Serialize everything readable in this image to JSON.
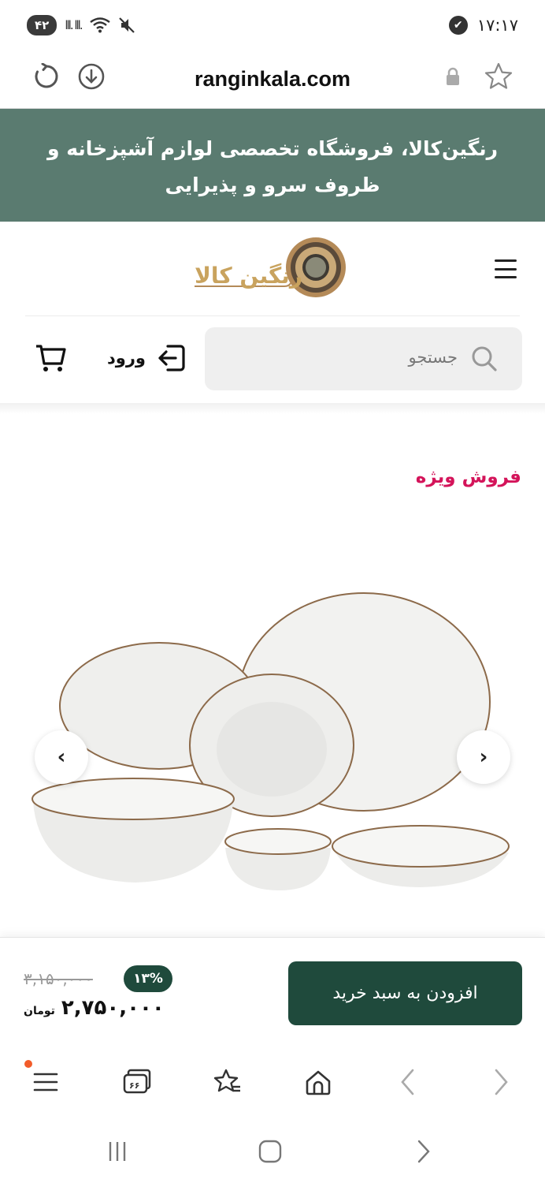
{
  "status_bar": {
    "time": "۱۷:۱۷",
    "battery": "۴۲",
    "signal": "lll. lll."
  },
  "browser": {
    "url": "ranginkala.com",
    "icons": [
      "refresh-icon",
      "download-icon",
      "lock-icon",
      "star-icon"
    ]
  },
  "banner": {
    "text": "رنگین‌کالا، فروشگاه تخصصی لوازم آشپزخانه و ظروف سرو و پذیرایی"
  },
  "header": {
    "logo_text": "رنگین کالا",
    "search_placeholder": "جستجو",
    "login_label": "ورود"
  },
  "section": {
    "title": "فروش ویژه"
  },
  "product": {
    "image": "white-dinnerware-set",
    "old_price": "۳,۱۵۰,۰۰۰",
    "discount": "۱۳%",
    "price": "۲,۷۵۰,۰۰۰",
    "currency": "تومان",
    "add_to_cart": "افزودن به سبد خرید"
  },
  "colors": {
    "banner": "#5a7b70",
    "primary": "#1f4a3c",
    "accent": "#d4145a"
  }
}
